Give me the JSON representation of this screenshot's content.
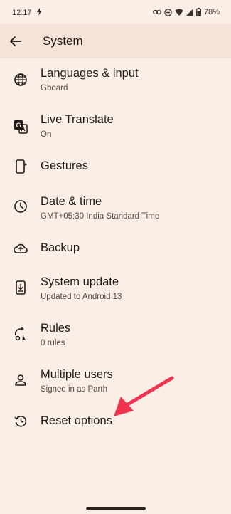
{
  "status_bar": {
    "time": "12:17",
    "battery": "78%",
    "icons": [
      "app-notification-icon",
      "link-icon",
      "do-not-disturb-icon",
      "wifi-icon",
      "signal-icon",
      "battery-icon"
    ]
  },
  "app_bar": {
    "title": "System",
    "back_icon": "arrow-back-icon"
  },
  "items": [
    {
      "title": "Languages & input",
      "subtitle": "Gboard",
      "icon": "globe-icon"
    },
    {
      "title": "Live Translate",
      "subtitle": "On",
      "icon": "translate-icon"
    },
    {
      "title": "Gestures",
      "subtitle": "",
      "icon": "phone-gesture-icon"
    },
    {
      "title": "Date & time",
      "subtitle": "GMT+05:30 India Standard Time",
      "icon": "clock-icon"
    },
    {
      "title": "Backup",
      "subtitle": "",
      "icon": "cloud-upload-icon"
    },
    {
      "title": "System update",
      "subtitle": "Updated to Android 13",
      "icon": "system-update-icon"
    },
    {
      "title": "Rules",
      "subtitle": "0 rules",
      "icon": "rules-icon"
    },
    {
      "title": "Multiple users",
      "subtitle": "Signed in as Parth",
      "icon": "person-icon"
    },
    {
      "title": "Reset options",
      "subtitle": "",
      "icon": "history-icon"
    }
  ],
  "colors": {
    "background": "#fbeee6",
    "app_bar": "#f6e3d7",
    "annotation_arrow": "#f0344f"
  }
}
